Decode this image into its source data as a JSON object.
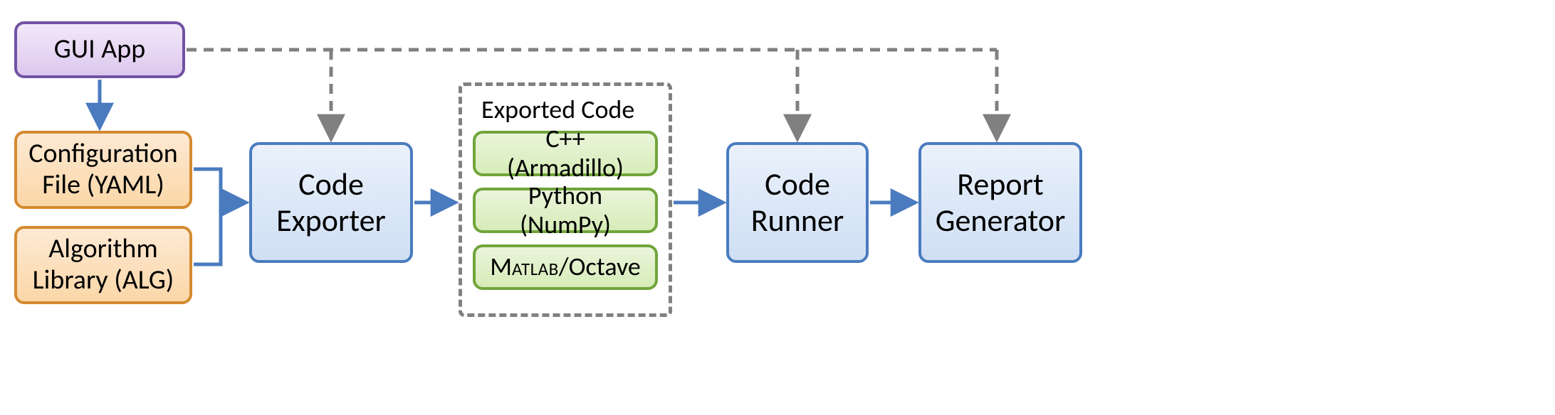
{
  "nodes": {
    "gui_app": "GUI App",
    "config_file": "Configuration File (YAML)",
    "algo_lib": "Algorithm Library (ALG)",
    "code_exporter": "Code Exporter",
    "exported_group": "Exported Code",
    "lang_cpp": "C++ (Armadillo)",
    "lang_python": "Python (NumPy)",
    "lang_matlab_a": "M",
    "lang_matlab_b": "atlab",
    "lang_matlab_c": "/Octave",
    "code_runner": "Code Runner",
    "report_gen": "Report Generator"
  },
  "colors": {
    "arrow_blue": "#4a7bbf",
    "arrow_gray": "#808080"
  },
  "edges_solid": [
    {
      "from": "gui_app",
      "to": "config_file"
    },
    {
      "from": "config_file",
      "to": "code_exporter"
    },
    {
      "from": "algo_lib",
      "to": "code_exporter"
    },
    {
      "from": "code_exporter",
      "to": "exported_code"
    },
    {
      "from": "exported_code",
      "to": "code_runner"
    },
    {
      "from": "code_runner",
      "to": "report_gen"
    }
  ],
  "edges_dashed": [
    {
      "from": "gui_app",
      "to": "code_exporter"
    },
    {
      "from": "gui_app",
      "to": "code_runner"
    },
    {
      "from": "gui_app",
      "to": "report_gen"
    }
  ]
}
